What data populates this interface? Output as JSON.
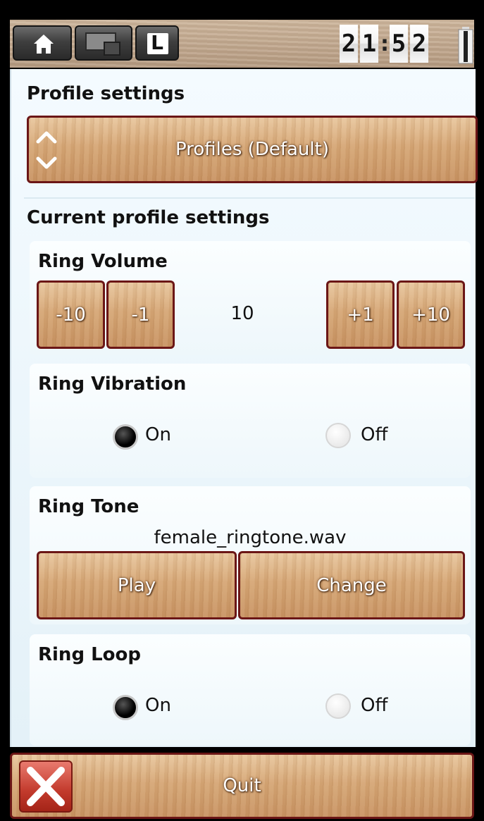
{
  "statusbar": {
    "clock_digits": [
      "2",
      "1",
      "5",
      "2"
    ],
    "clock_separator": ":",
    "home_icon": "home-icon",
    "window_icon": "window-switch-icon",
    "l_icon": "l-icon",
    "battery_icon": "battery-icon",
    "l_label": "L"
  },
  "profile_settings": {
    "title": "Profile settings",
    "selector_label": "Profiles (Default)",
    "up_icon": "chevron-up-icon",
    "down_icon": "chevron-down-icon"
  },
  "current_profile": {
    "title": "Current profile settings",
    "ring_volume": {
      "title": "Ring Volume",
      "value": "10",
      "buttons": [
        "-10",
        "-1",
        "+1",
        "+10"
      ]
    },
    "ring_vibration": {
      "title": "Ring Vibration",
      "on_label": "On",
      "off_label": "Off",
      "selected": "On"
    },
    "ring_tone": {
      "title": "Ring Tone",
      "file": "female_ringtone.wav",
      "play_label": "Play",
      "change_label": "Change"
    },
    "ring_loop": {
      "title": "Ring Loop",
      "on_label": "On",
      "off_label": "Off",
      "selected": "On"
    }
  },
  "quit": {
    "label": "Quit",
    "icon": "close-icon"
  },
  "colors": {
    "button_border": "#6b1616",
    "panel_bg": "#eef7fb",
    "quit_icon_red": "#c23a2c"
  }
}
